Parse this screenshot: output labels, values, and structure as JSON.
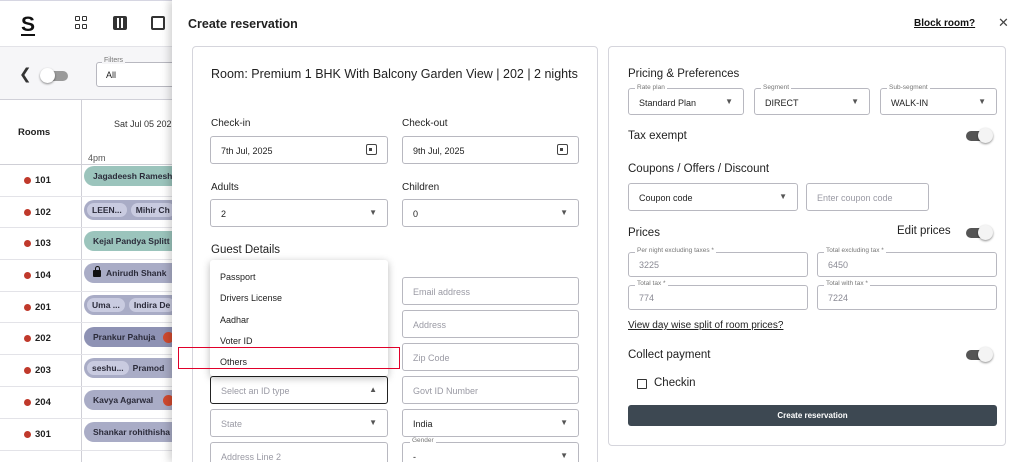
{
  "app": {
    "logo": "S",
    "filters": {
      "legend": "Filters",
      "value": "All"
    },
    "date_header": "Sat Jul 05 202",
    "rooms_header": "Rooms",
    "time_label": "4pm",
    "rooms": [
      {
        "number": "101",
        "bookings": [
          "Jagadeesh Ramesh"
        ]
      },
      {
        "number": "102",
        "bookings": [
          "LEEN...",
          "Mihir Ch"
        ]
      },
      {
        "number": "103",
        "bookings": [
          "Kejal Pandya Splitt"
        ]
      },
      {
        "number": "104",
        "bookings": [
          "Anirudh Shank"
        ]
      },
      {
        "number": "201",
        "bookings": [
          "Uma ...",
          "Indira De"
        ]
      },
      {
        "number": "202",
        "bookings": [
          "Prankur Pahuja"
        ]
      },
      {
        "number": "203",
        "bookings": [
          "seshu...",
          "Pramod"
        ]
      },
      {
        "number": "204",
        "bookings": [
          "Kavya Agarwal"
        ]
      },
      {
        "number": "301",
        "bookings": [
          "Shankar rohithisha"
        ]
      }
    ]
  },
  "modal": {
    "title": "Create reservation",
    "block_room": "Block room?",
    "close": "✕",
    "room_title": "Room: Premium 1 BHK With Balcony Garden View | 202 | 2 nights",
    "checkin": {
      "label": "Check-in",
      "value": "7th Jul, 2025"
    },
    "checkout": {
      "label": "Check-out",
      "value": "9th Jul, 2025"
    },
    "adults": {
      "label": "Adults",
      "value": "2"
    },
    "children": {
      "label": "Children",
      "value": "0"
    },
    "guest_details": "Guest Details",
    "id_options": [
      "Passport",
      "Drivers License",
      "Aadhar",
      "Voter ID",
      "Others"
    ],
    "id_type_placeholder": "Select an ID type",
    "email_placeholder": "Email address",
    "address_placeholder": "Address",
    "zip_placeholder": "Zip Code",
    "govt_id_placeholder": "Govt ID Number",
    "state_placeholder": "State",
    "country_value": "India",
    "address2_placeholder": "Address Line 2",
    "gender": {
      "legend": "Gender",
      "value": "-"
    }
  },
  "pricing": {
    "title": "Pricing & Preferences",
    "rate_plan": {
      "legend": "Rate plan",
      "value": "Standard Plan"
    },
    "segment": {
      "legend": "Segment",
      "value": "DIRECT"
    },
    "sub_segment": {
      "legend": "Sub-segment",
      "value": "WALK-IN"
    },
    "tax_exempt": "Tax exempt",
    "coupons_title": "Coupons / Offers / Discount",
    "coupon_code": "Coupon code",
    "coupon_placeholder": "Enter coupon code",
    "prices_title": "Prices",
    "edit_prices": "Edit prices",
    "per_night": {
      "legend": "Per night excluding taxes *",
      "value": "3225"
    },
    "total_excl": {
      "legend": "Total excluding tax *",
      "value": "6450"
    },
    "total_tax": {
      "legend": "Total tax *",
      "value": "774"
    },
    "total_with_tax": {
      "legend": "Total with tax *",
      "value": "7224"
    },
    "day_wise_link": "View day wise split of room prices?",
    "collect_payment": "Collect payment",
    "checkin_label": "Checkin",
    "create_button": "Create reservation"
  }
}
